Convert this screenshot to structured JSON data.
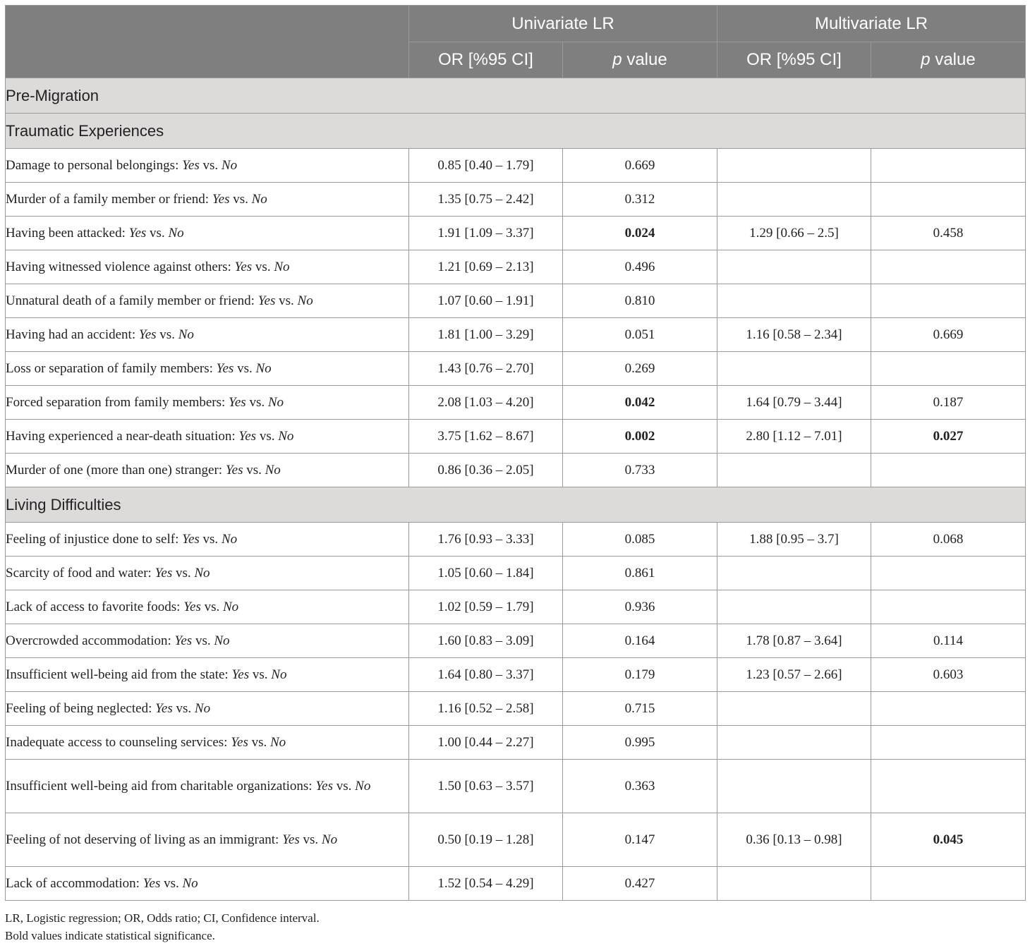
{
  "header": {
    "uni": "Univariate LR",
    "multi": "Multivariate LR",
    "or_ci": "OR [%95 CI]",
    "p_italic": "p",
    "p_rest": " value"
  },
  "sections": {
    "pre": "Pre-Migration",
    "trauma": "Traumatic Experiences",
    "living": "Living Difficulties"
  },
  "yes": "Yes",
  "vs": " vs. ",
  "no": "No",
  "rows": [
    {
      "label": "Damage to personal belongings: ",
      "uor": "0.85 [0.40 – 1.79]",
      "up": "0.669",
      "mor": "",
      "mp": ""
    },
    {
      "label": "Murder of a family member or friend: ",
      "uor": "1.35 [0.75 – 2.42]",
      "up": "0.312",
      "mor": "",
      "mp": ""
    },
    {
      "label": "Having been attacked: ",
      "uor": "1.91 [1.09 – 3.37]",
      "up": "0.024",
      "mor": "1.29 [0.66 – 2.5]",
      "mp": "0.458"
    },
    {
      "label": "Having witnessed violence against others: ",
      "uor": "1.21 [0.69 – 2.13]",
      "up": "0.496",
      "mor": "",
      "mp": ""
    },
    {
      "label": "Unnatural death of a family member or friend: ",
      "uor": "1.07 [0.60 – 1.91]",
      "up": "0.810",
      "mor": "",
      "mp": ""
    },
    {
      "label": "Having had an accident: ",
      "uor": "1.81 [1.00 – 3.29]",
      "up": "0.051",
      "mor": "1.16 [0.58 – 2.34]",
      "mp": "0.669"
    },
    {
      "label": "Loss or separation of family members: ",
      "uor": "1.43 [0.76 – 2.70]",
      "up": "0.269",
      "mor": "",
      "mp": ""
    },
    {
      "label": "Forced separation from family members: ",
      "uor": "2.08 [1.03 – 4.20]",
      "up": "0.042",
      "mor": "1.64 [0.79 – 3.44]",
      "mp": "0.187"
    },
    {
      "label": "Having experienced a near-death situation: ",
      "uor": "3.75 [1.62 – 8.67]",
      "up": "0.002",
      "mor": "2.80 [1.12 – 7.01]",
      "mp": "0.027"
    },
    {
      "label": "Murder of one (more than one) stranger: ",
      "uor": "0.86 [0.36 – 2.05]",
      "up": "0.733",
      "mor": "",
      "mp": ""
    },
    {
      "label": "Feeling of injustice done to self: ",
      "uor": "1.76 [0.93 – 3.33]",
      "up": "0.085",
      "mor": "1.88 [0.95 – 3.7]",
      "mp": "0.068"
    },
    {
      "label": "Scarcity of food and water: ",
      "uor": "1.05 [0.60 – 1.84]",
      "up": "0.861",
      "mor": "",
      "mp": ""
    },
    {
      "label": "Lack of access to favorite foods: ",
      "uor": "1.02 [0.59 – 1.79]",
      "up": "0.936",
      "mor": "",
      "mp": ""
    },
    {
      "label": "Overcrowded accommodation: ",
      "uor": "1.60 [0.83 – 3.09]",
      "up": "0.164",
      "mor": "1.78 [0.87 – 3.64]",
      "mp": "0.114"
    },
    {
      "label": "Insufficient well-being aid from the state: ",
      "uor": "1.64 [0.80 – 3.37]",
      "up": "0.179",
      "mor": "1.23 [0.57 – 2.66]",
      "mp": "0.603"
    },
    {
      "label": "Feeling of being neglected: ",
      "uor": "1.16 [0.52 – 2.58]",
      "up": "0.715",
      "mor": "",
      "mp": ""
    },
    {
      "label": "Inadequate access to counseling services: ",
      "uor": "1.00 [0.44 – 2.27]",
      "up": "0.995",
      "mor": "",
      "mp": ""
    },
    {
      "label": "Insufficient well-being aid from charitable organizations: ",
      "uor": "1.50 [0.63 – 3.57]",
      "up": "0.363",
      "mor": "",
      "mp": ""
    },
    {
      "label": "Feeling of not deserving of living as an immigrant: ",
      "uor": "0.50 [0.19 – 1.28]",
      "up": "0.147",
      "mor": "0.36 [0.13 – 0.98]",
      "mp": "0.045"
    },
    {
      "label": "Lack of accommodation: ",
      "uor": "1.52 [0.54 – 4.29]",
      "up": "0.427",
      "mor": "",
      "mp": ""
    }
  ],
  "footnotes": [
    "LR, Logistic regression; OR, Odds ratio; CI, Confidence interval.",
    "Bold values indicate statistical significance."
  ]
}
